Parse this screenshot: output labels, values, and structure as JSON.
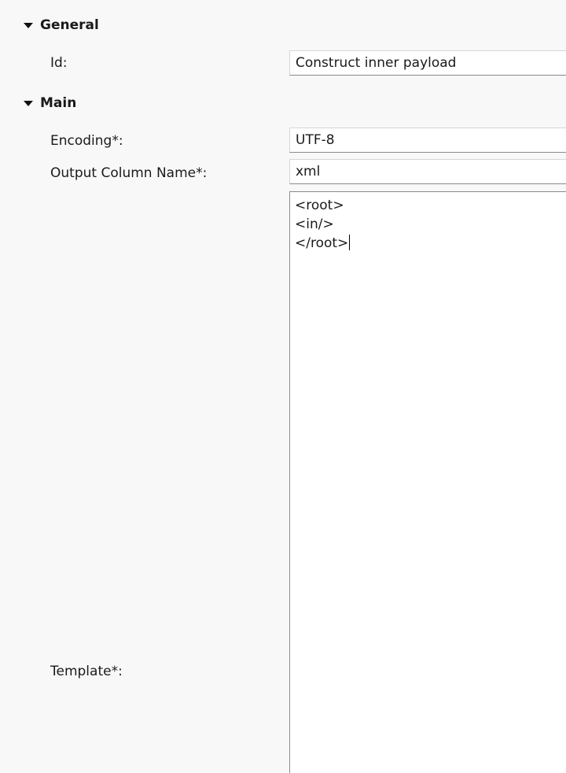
{
  "sections": {
    "general": {
      "title": "General",
      "id_label": "Id:",
      "id_value": "Construct inner payload"
    },
    "main": {
      "title": "Main",
      "encoding_label": "Encoding*:",
      "encoding_value": "UTF-8",
      "output_column_label": "Output Column Name*:",
      "output_column_value": "xml",
      "template_label": "Template*:",
      "template_lines": [
        "<root>",
        "<in/>",
        "</root>"
      ]
    }
  },
  "icons": {
    "expand": "chevron-down-icon"
  }
}
